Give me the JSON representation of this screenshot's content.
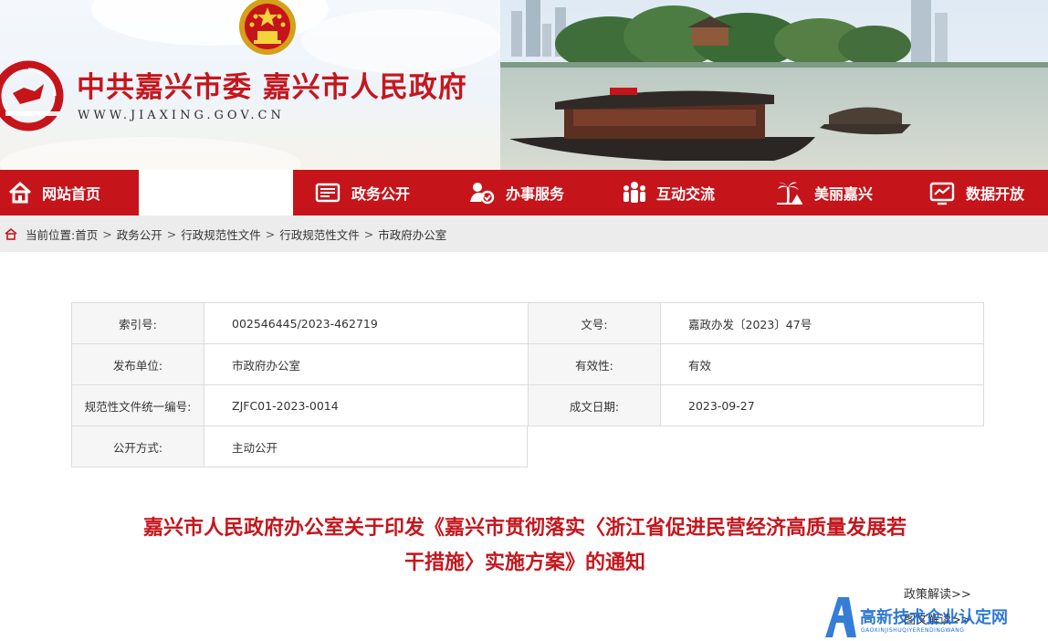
{
  "header": {
    "site_title": "中共嘉兴市委 嘉兴市人民政府",
    "site_url": "WWW.JIAXING.GOV.CN"
  },
  "nav": {
    "items": [
      {
        "label": "网站首页",
        "icon": "home-icon"
      },
      {
        "label": "",
        "icon": ""
      },
      {
        "label": "政务公开",
        "icon": "document-list-icon"
      },
      {
        "label": "办事服务",
        "icon": "person-service-icon"
      },
      {
        "label": "互动交流",
        "icon": "people-group-icon"
      },
      {
        "label": "美丽嘉兴",
        "icon": "palm-tree-icon"
      },
      {
        "label": "数据开放",
        "icon": "data-screen-icon"
      }
    ]
  },
  "breadcrumb": {
    "prefix": "当前位置:",
    "items": [
      "首页",
      "政务公开",
      "行政规范性文件",
      "行政规范性文件",
      "市政府办公室"
    ],
    "separator": ">"
  },
  "meta": {
    "rows": [
      [
        {
          "key": "索引号:",
          "value": "002546445/2023-462719"
        },
        {
          "key": "文号:",
          "value": "嘉政办发〔2023〕47号"
        }
      ],
      [
        {
          "key": "发布单位:",
          "value": "市政府办公室"
        },
        {
          "key": "有效性:",
          "value": "有效"
        }
      ],
      [
        {
          "key": "规范性文件统一编号:",
          "value": "ZJFC01-2023-0014"
        },
        {
          "key": "成文日期:",
          "value": "2023-09-27"
        }
      ],
      [
        {
          "key": "公开方式:",
          "value": "主动公开"
        }
      ]
    ]
  },
  "article": {
    "title_line1": "嘉兴市人民政府办公室关于印发《嘉兴市贯彻落实〈浙江省促进民营经济高质量发展若",
    "title_line2": "干措施〉实施方案》的通知",
    "policy_link": "政策解读>>",
    "policy_link2": "图文解读>>"
  },
  "watermark": {
    "text": "高新技术企业认定网",
    "sub": "GAOXINJISHUQIYERENDINGWANG"
  },
  "colors": {
    "brand_red": "#c6141b",
    "title_red": "#c5161d",
    "watermark_blue": "#1f6fd1"
  }
}
